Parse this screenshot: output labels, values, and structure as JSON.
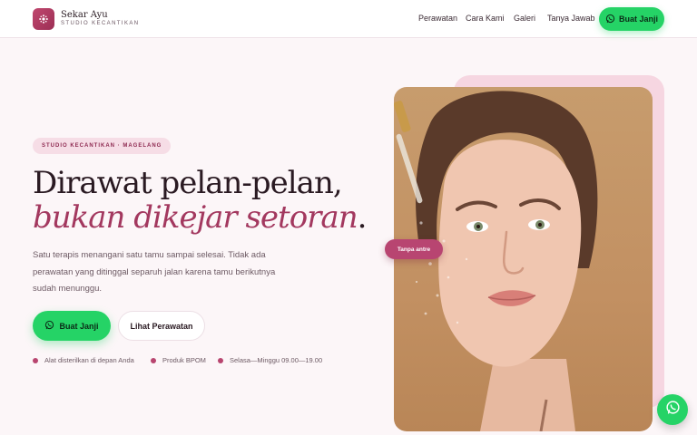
{
  "brand": {
    "name": "Sekar Ayu",
    "subtitle": "STUDIO KECANTIKAN"
  },
  "nav": {
    "items": [
      {
        "label": "Perawatan"
      },
      {
        "label": "Cara Kami"
      },
      {
        "label": "Galeri"
      },
      {
        "label": "Tanya Jawab"
      }
    ],
    "cta_label": "Buat Janji"
  },
  "hero": {
    "badge": "STUDIO KECANTIKAN · MAGELANG",
    "headline_line1": "Dirawat pelan-pelan,",
    "headline_line2": "bukan dikejar setoran",
    "headline_punct": ".",
    "lead": "Satu terapis menangani satu tamu sampai selesai. Tidak ada perawatan yang ditinggal separuh jalan karena tamu berikutnya sudah menunggu.",
    "primary_cta": "Buat Janji",
    "secondary_cta": "Lihat Perawatan",
    "features": [
      {
        "label": "Alat disterilkan di depan Anda"
      },
      {
        "label": "Produk BPOM"
      },
      {
        "label": "Selasa—Minggu 09.00—19.00"
      }
    ],
    "floating_pill": "Tanpa antre"
  },
  "icons": {
    "logo": "flower-icon",
    "whatsapp": "whatsapp-icon"
  },
  "colors": {
    "accent": "#a3385f",
    "whatsapp": "#25d366",
    "background": "#fcf6f8"
  }
}
